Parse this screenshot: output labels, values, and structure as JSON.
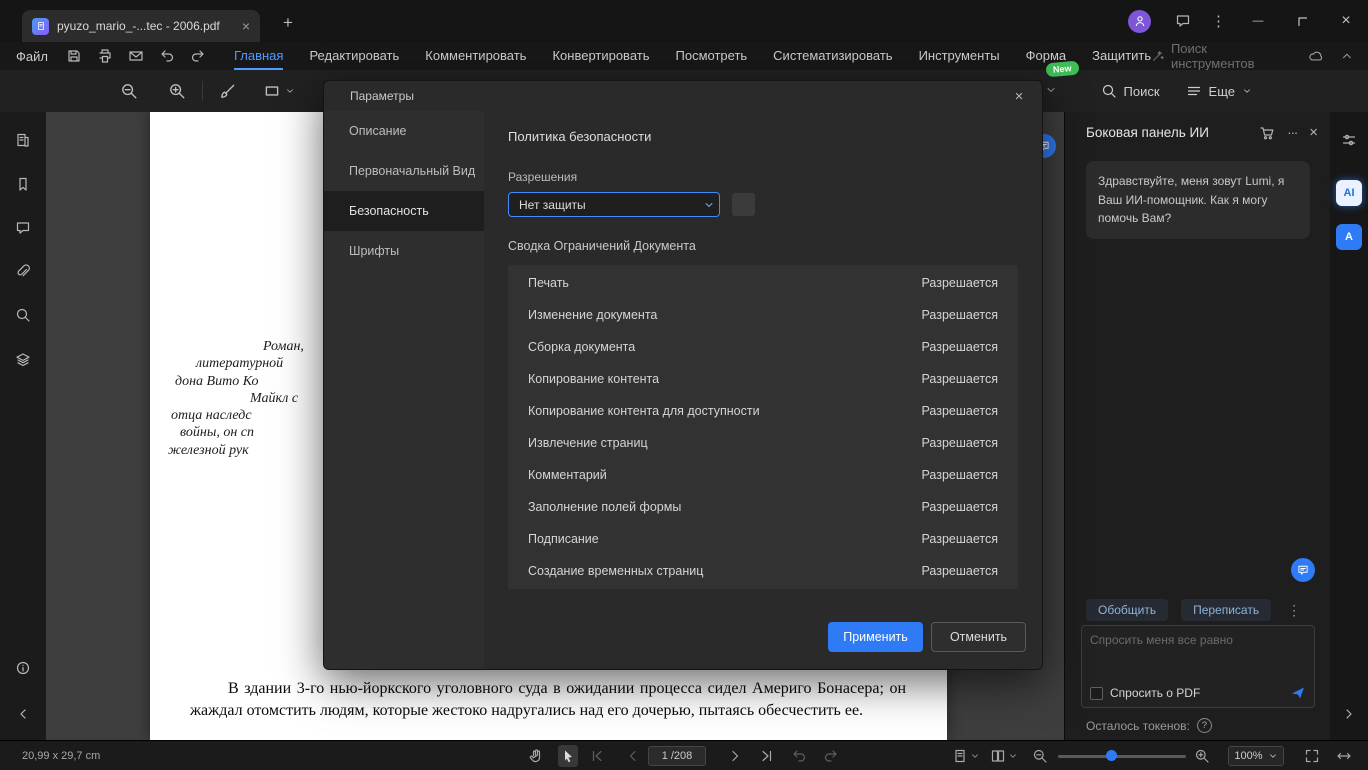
{
  "icons": {
    "close": "×",
    "plus": "+",
    "dots_v": "⋮",
    "dots_h": "···",
    "minimize": "—",
    "question": "?"
  },
  "window": {
    "tab_title": "pyuzo_mario_-...tec - 2006.pdf"
  },
  "menubar": {
    "file": "Файл",
    "tabs": [
      "Главная",
      "Редактировать",
      "Комментировать",
      "Конвертировать",
      "Посмотреть",
      "Систематизировать",
      "Инструменты",
      "Форма",
      "Защитить"
    ],
    "active_tab": "Главная",
    "search_tools": "Поиск инструментов"
  },
  "toolbar": {
    "search": "Поиск",
    "more": "Еще",
    "new_badge": "New"
  },
  "dialog": {
    "title": "Параметры",
    "tabs": [
      "Описание",
      "Первоначальный Вид",
      "Безопасность",
      "Шрифты"
    ],
    "active_tab": "Безопасность",
    "section_title": "Политика безопасности",
    "permissions_label": "Разрешения",
    "permissions_value": "Нет защиты",
    "summary_title": "Сводка Ограничений Документа",
    "rows": [
      {
        "label": "Печать",
        "value": "Разрешается"
      },
      {
        "label": "Изменение документа",
        "value": "Разрешается"
      },
      {
        "label": "Сборка документа",
        "value": "Разрешается"
      },
      {
        "label": "Копирование контента",
        "value": "Разрешается"
      },
      {
        "label": "Копирование контента для доступности",
        "value": "Разрешается"
      },
      {
        "label": "Извлечение страниц",
        "value": "Разрешается"
      },
      {
        "label": "Комментарий",
        "value": "Разрешается"
      },
      {
        "label": "Заполнение полей формы",
        "value": "Разрешается"
      },
      {
        "label": "Подписание",
        "value": "Разрешается"
      },
      {
        "label": "Создание временных страниц",
        "value": "Разрешается"
      }
    ],
    "apply": "Применить",
    "cancel": "Отменить"
  },
  "ai_panel": {
    "title": "Боковая панель ИИ",
    "greeting": "Здравствуйте, меня зовут Lumi, я Ваш ИИ-помощник. Как я могу помочь Вам?",
    "summarize": "Обобщить",
    "rewrite": "Переписать",
    "input_placeholder": "Спросить меня все равно",
    "ask_pdf_label": "Спросить о PDF",
    "tokens_label": "Осталось токенов:"
  },
  "document": {
    "excerpt_lines": [
      "Роман,",
      "литературной",
      "дона Вито Ко",
      "Майкл с",
      "отца наследс",
      "войны, он сп",
      "железной рук"
    ],
    "paragraph": "В здании 3-го нью-йоркского уголовного суда в ожидании процесса сидел Америго Бонасера; он жаждал отомстить людям, которые жестоко надругались над его дочерью, пытаясь обесчестить ее."
  },
  "statusbar": {
    "page_size": "20,99 x 29,7 cm",
    "page_current": "1",
    "page_total": "/208",
    "zoom": "100%"
  }
}
